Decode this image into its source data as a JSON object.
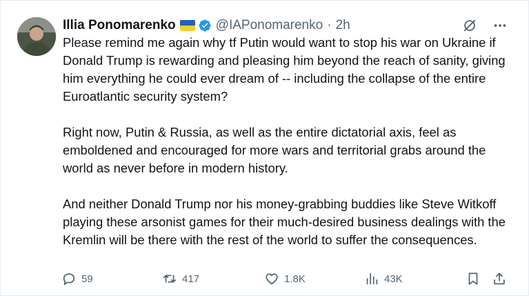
{
  "tweet": {
    "author_name": "Illia Ponomarenko",
    "handle": "@IAPonomarenko",
    "separator": "·",
    "time": "2h",
    "paragraphs": [
      "Please remind me again why tf Putin would want to stop his war on Ukraine if Donald Trump is rewarding and pleasing him beyond the reach of sanity, giving him everything he could ever dream of -- including the collapse of the entire Euroatlantic security system?",
      "Right now, Putin & Russia, as well as the entire dictatorial axis, feel as emboldened and encouraged for more wars and territorial grabs around the world as never before in modern history.",
      "And neither Donald Trump nor his money-grabbing buddies like Steve Witkoff playing these arsonist games for their much-desired business dealings with the Kremlin will be there with the rest of the world to suffer the consequences."
    ],
    "icons": {
      "flag": "ukraine-flag-icon",
      "verified": "verified-badge-icon",
      "grok": "grok-icon",
      "more": "more-icon"
    },
    "actions": {
      "replies": "59",
      "reposts": "417",
      "likes": "1.8K",
      "views": "43K"
    },
    "colors": {
      "verified_blue": "#1d9bf0",
      "secondary_text": "#536471",
      "primary_text": "#0f1419",
      "flag_blue": "#1f5fbf",
      "flag_yellow": "#f6d022"
    }
  }
}
